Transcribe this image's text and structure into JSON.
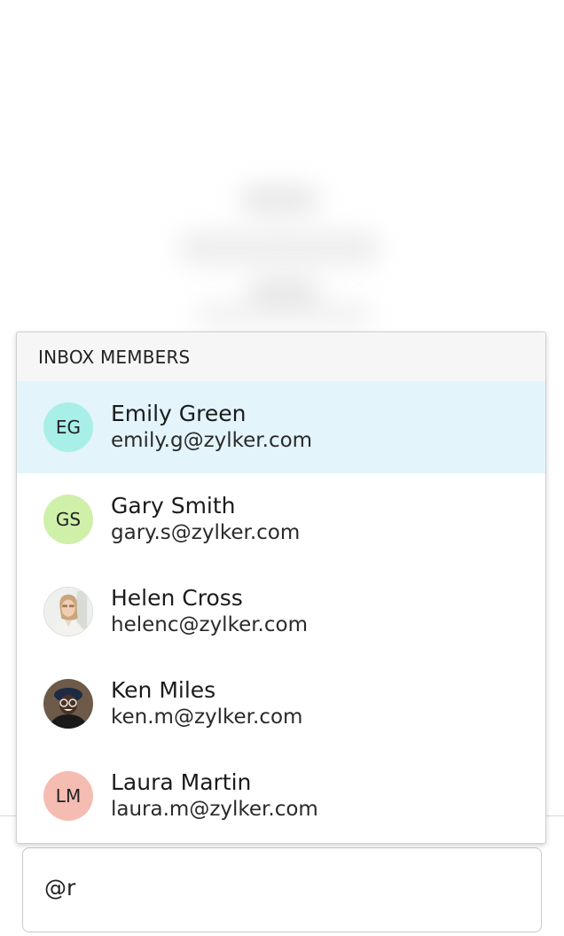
{
  "dropdown": {
    "header": "INBOX MEMBERS",
    "members": [
      {
        "initials": "EG",
        "name": "Emily Green",
        "email": "emily.g@zylker.com",
        "avatar_color": "#a8efe8",
        "highlighted": true
      },
      {
        "initials": "GS",
        "name": "Gary Smith",
        "email": "gary.s@zylker.com",
        "avatar_color": "#cff0a9",
        "highlighted": false
      },
      {
        "initials": "",
        "name": "Helen Cross",
        "email": "helenc@zylker.com",
        "avatar_photo": true,
        "highlighted": false
      },
      {
        "initials": "",
        "name": "Ken Miles",
        "email": "ken.m@zylker.com",
        "avatar_photo": true,
        "highlighted": false
      },
      {
        "initials": "LM",
        "name": "Laura Martin",
        "email": "laura.m@zylker.com",
        "avatar_color": "#f5bcb2",
        "highlighted": false
      }
    ],
    "highlight_color": "#e3f4fb"
  },
  "composer": {
    "value": "@r"
  }
}
